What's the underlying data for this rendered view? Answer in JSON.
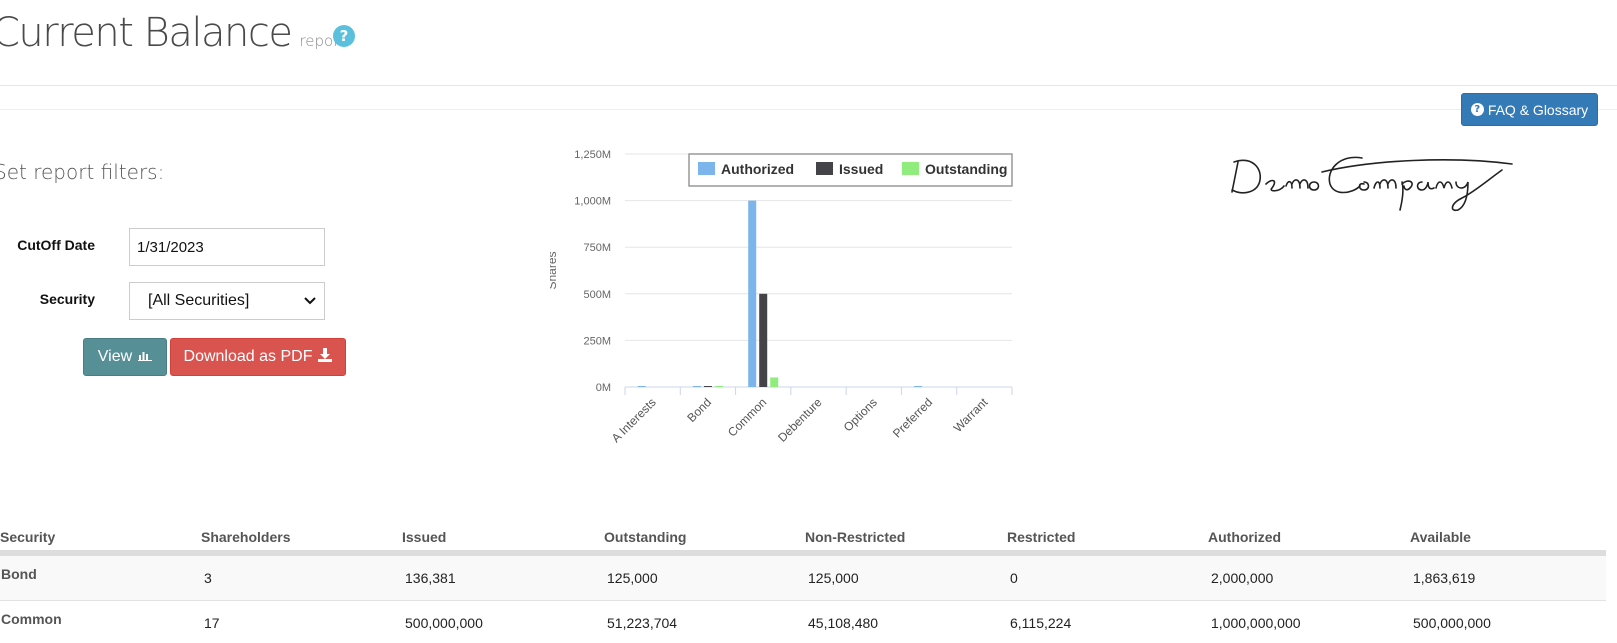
{
  "header": {
    "title": "Current Balance",
    "subtitle": "report",
    "help_glyph": "?",
    "faq_label": "FAQ & Glossary"
  },
  "filters": {
    "title": "Set report filters:",
    "cutoff_label": "CutOff Date",
    "cutoff_value": "1/31/2023",
    "security_label": "Security",
    "security_selected": "[All Securities]",
    "view_label": "View",
    "pdf_label": "Download as PDF"
  },
  "logo": {
    "text": "DemoCompany"
  },
  "colors": {
    "authorized": "#7cb5ec",
    "issued": "#434348",
    "outstanding": "#90ed7d",
    "view_button": "#568f96",
    "pdf_button": "#d9534f",
    "faq_button": "#337ab7",
    "help_icon": "#5bc0de"
  },
  "icons": {
    "help": "question-circle-icon",
    "faq": "question-circle-icon",
    "view": "bar-chart-icon",
    "pdf": "download-icon",
    "select": "chevron-down-icon"
  },
  "chart_data": {
    "type": "bar",
    "ylabel": "Shares",
    "xlabel": "",
    "ylim": [
      0,
      1250
    ],
    "yticks": [
      "0M",
      "250M",
      "500M",
      "750M",
      "1,000M",
      "1,250M"
    ],
    "legend_position": "top-right",
    "grid": true,
    "categories": [
      "A Interests",
      "Bond",
      "Common",
      "Debenture",
      "Options",
      "Preferred",
      "Warrant"
    ],
    "series": [
      {
        "name": "Authorized",
        "values": [
          2,
          2,
          1000,
          0,
          0,
          3,
          0
        ]
      },
      {
        "name": "Issued",
        "values": [
          0,
          0.14,
          500,
          0,
          0,
          0,
          0
        ]
      },
      {
        "name": "Outstanding",
        "values": [
          0,
          0.13,
          51.2,
          0,
          0,
          0,
          0
        ]
      }
    ]
  },
  "table": {
    "columns": [
      "Security",
      "Shareholders",
      "Issued",
      "Outstanding",
      "Non-Restricted",
      "Restricted",
      "Authorized",
      "Available"
    ],
    "rows": [
      [
        "Bond",
        "3",
        "136,381",
        "125,000",
        "125,000",
        "0",
        "2,000,000",
        "1,863,619"
      ],
      [
        "Common",
        "17",
        "500,000,000",
        "51,223,704",
        "45,108,480",
        "6,115,224",
        "1,000,000,000",
        "500,000,000"
      ]
    ]
  }
}
